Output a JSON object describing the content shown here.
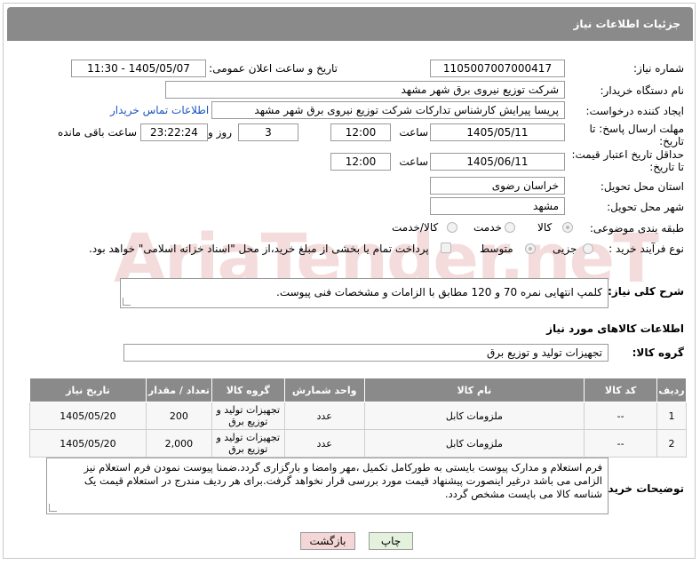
{
  "header": {
    "title": "جزئیات اطلاعات نیاز"
  },
  "form": {
    "need_number_label": "شماره نیاز:",
    "need_number": "1105007007000417",
    "announce_label": "تاریخ و ساعت اعلان عمومی:",
    "announce_value": "1405/05/07 - 11:30",
    "buyer_label": "نام دستگاه خریدار:",
    "buyer_value": "شرکت توزیع نیروی برق شهر مشهد",
    "creator_label": "ایجاد کننده درخواست:",
    "creator_value": "پریسا پیرایش کارشناس تدارکات شرکت توزیع نیروی برق شهر مشهد",
    "contact_link": "اطلاعات تماس خریدار",
    "reply_label_1": "مهلت ارسال پاسخ: تا",
    "reply_label_2": "تاریخ:",
    "reply_date": "1405/05/11",
    "time_label": "ساعت",
    "reply_time": "12:00",
    "reply_days": "3",
    "days_label": "روز و",
    "remaining_time": "23:22:24",
    "remaining_label": "ساعت باقی مانده",
    "price_label_1": "حداقل تاریخ اعتبار قیمت:",
    "price_label_2": "تا تاریخ:",
    "price_date": "1405/06/11",
    "price_time": "12:00",
    "province_label": "استان محل تحویل:",
    "province_value": "خراسان رضوی",
    "city_label": "شهر محل تحویل:",
    "city_value": "مشهد",
    "category_label": "طبقه بندی موضوعی:",
    "category_options": [
      "کالا",
      "خدمت",
      "کالا/خدمت"
    ],
    "process_label": "نوع فرآیند خرید :",
    "process_options": [
      "جزیی",
      "متوسط"
    ],
    "payment_text": "پرداخت تمام یا بخشی از مبلغ خرید،از محل \"اسناد خزانه اسلامی\" خواهد بود."
  },
  "description": {
    "label": "شرح کلی نیاز:",
    "text": "کلمپ انتهایی نمره 70  و 120 مطابق با الزامات و مشخصات فنی پیوست."
  },
  "goods": {
    "section_title": "اطلاعات کالاهای مورد نیاز",
    "group_label": "گروه کالا:",
    "group_value": "تجهیزات تولید و توزیع برق",
    "columns": [
      "ردیف",
      "کد کالا",
      "نام کالا",
      "واحد شمارش",
      "گروه کالا",
      "تعداد / مقدار",
      "تاریخ نیاز"
    ],
    "rows": [
      {
        "row": "1",
        "code": "--",
        "name": "ملزومات کابل",
        "unit": "عدد",
        "group": "تجهیزات تولید و توزیع برق",
        "qty": "200",
        "date": "1405/05/20"
      },
      {
        "row": "2",
        "code": "--",
        "name": "ملزومات کابل",
        "unit": "عدد",
        "group": "تجهیزات تولید و توزیع برق",
        "qty": "2,000",
        "date": "1405/05/20"
      }
    ]
  },
  "buyer_notes": {
    "label": "توضیحات خریدار:",
    "text": "فرم استعلام و مدارک پیوست بایستی به طورکامل تکمیل ،مهر وامضا و بارگزاری گردد.ضمنا پیوست نمودن فرم استعلام نیز الزامی می باشد درغیر اینصورت پیشنهاد قیمت مورد بررسی قرار نخواهد گرفت.برای هر ردیف مندرج در استعلام قیمت یک شناسه کالا می بایست مشخص گردد."
  },
  "buttons": {
    "print": "چاپ",
    "back": "بازگشت"
  },
  "watermark": {
    "text": "AriaTender.neT"
  },
  "colors": {
    "header_bg": "#8a8a8a",
    "link": "#1a55c0",
    "back_button_bg": "#f4d6d6",
    "print_button_bg": "#e4f2dd"
  }
}
